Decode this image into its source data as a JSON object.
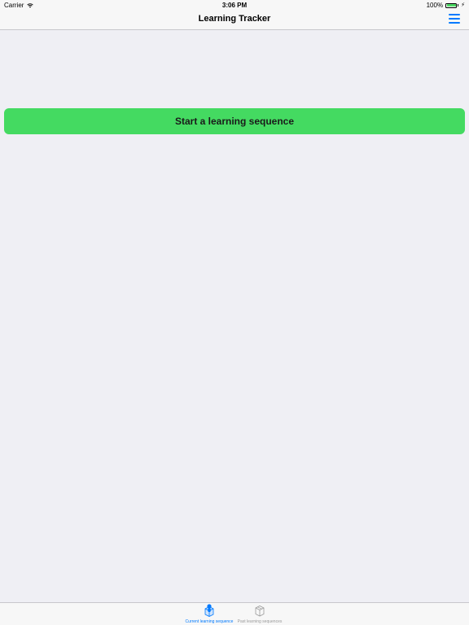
{
  "status_bar": {
    "carrier": "Carrier",
    "time": "3:06 PM",
    "battery": "100%"
  },
  "nav": {
    "title": "Learning Tracker",
    "menu_icon": "hamburger-menu-icon"
  },
  "main": {
    "start_button_label": "Start a learning sequence"
  },
  "tab_bar": {
    "tabs": [
      {
        "label": "Current learning sequence",
        "icon": "cube-person-icon",
        "selected": true
      },
      {
        "label": "Past learning sequences",
        "icon": "cube-icon",
        "selected": false
      }
    ]
  },
  "colors": {
    "accent": "#007aff",
    "button_green": "#44da61",
    "background": "#efeff4"
  }
}
